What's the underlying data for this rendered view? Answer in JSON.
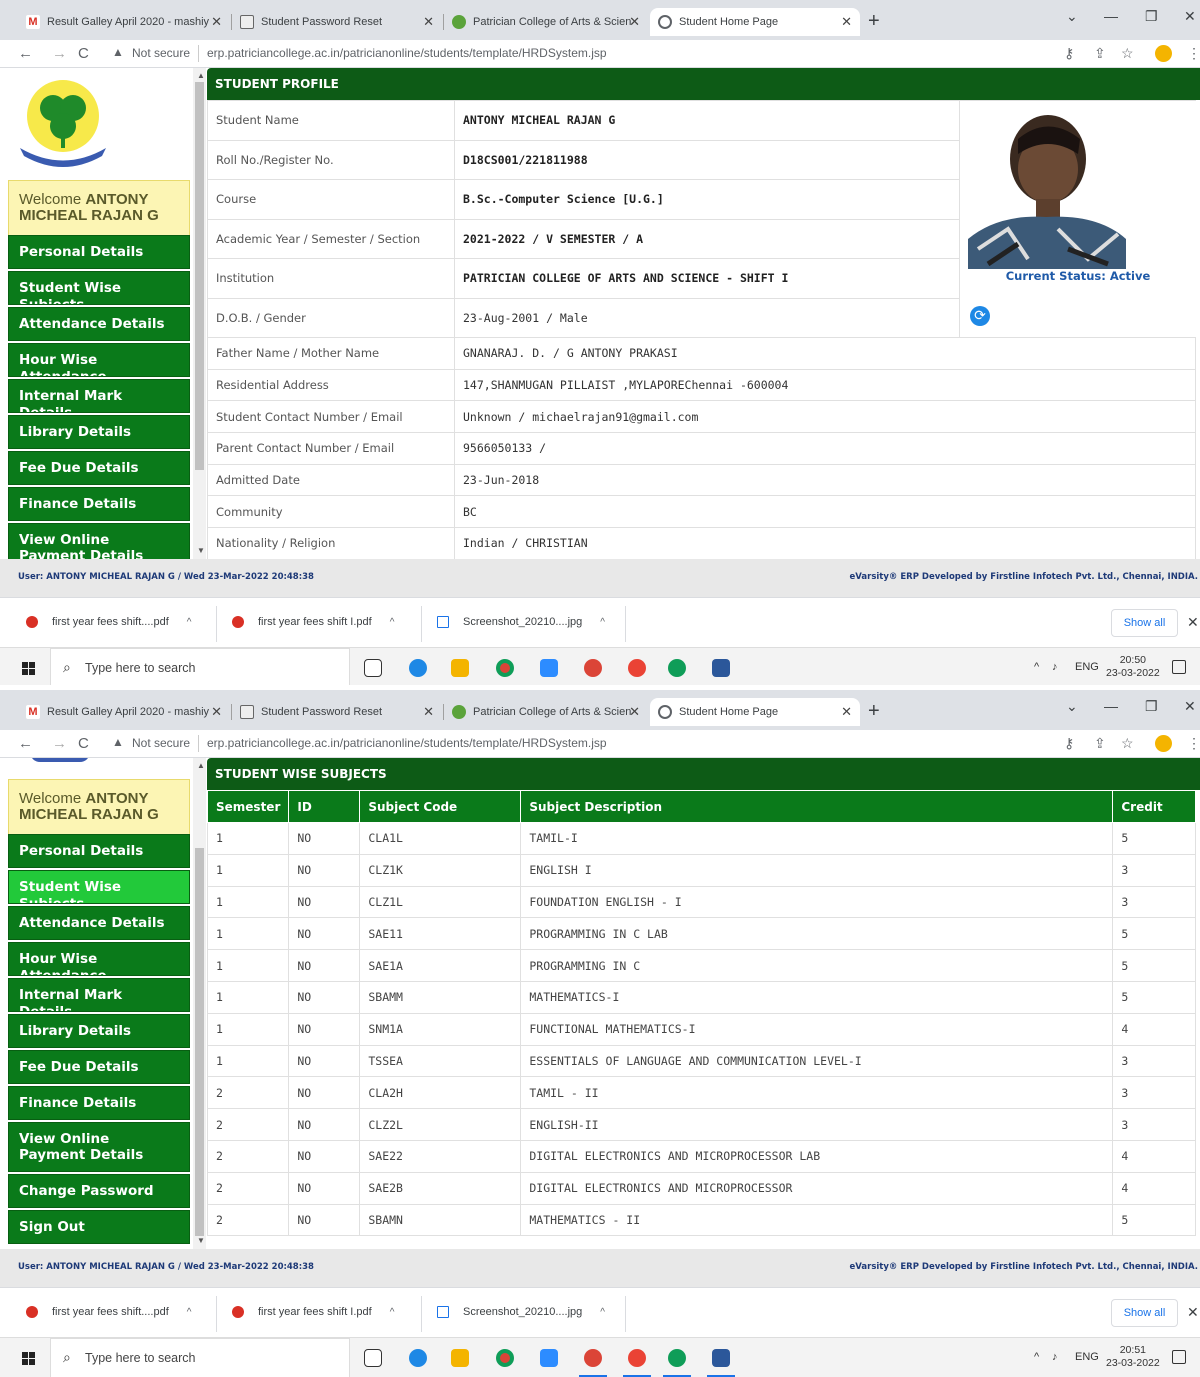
{
  "browser": {
    "tabs": [
      {
        "title": "Result Galley April 2020 - mashiy",
        "favicon": "gmail-icon"
      },
      {
        "title": "Student Password Reset",
        "favicon": "image-icon"
      },
      {
        "title": "Patrician College of Arts & Scien",
        "favicon": "college-icon"
      },
      {
        "title": "Student Home Page",
        "favicon": "globe-icon"
      }
    ],
    "not_secure": "Not secure",
    "url": "erp.patriciancollege.ac.in/patricianonline/students/template/HRDSystem.jsp"
  },
  "sidebar": {
    "welcome_prefix": "Welcome",
    "welcome_name": "ANTONY MICHEAL RAJAN G",
    "menu": [
      "Personal Details",
      "Student Wise Subjects",
      "Attendance Details",
      "Hour Wise Attendance",
      "Internal Mark Details",
      "Library Details",
      "Fee Due Details",
      "Finance Details",
      "View Online Payment Details",
      "Change Password",
      "Sign Out"
    ]
  },
  "profile": {
    "header": "STUDENT PROFILE",
    "rows": [
      {
        "label": "Student Name",
        "value": "ANTONY MICHEAL RAJAN G"
      },
      {
        "label": "Roll No./Register No.",
        "value": "D18CS001/221811988"
      },
      {
        "label": "Course",
        "value": "B.Sc.-Computer Science [U.G.]"
      },
      {
        "label": "Academic Year / Semester / Section",
        "value": "2021-2022 / V SEMESTER / A"
      },
      {
        "label": "Institution",
        "value": "PATRICIAN COLLEGE OF ARTS AND SCIENCE - SHIFT I"
      },
      {
        "label": "D.O.B. / Gender",
        "value": "23-Aug-2001 / Male"
      },
      {
        "label": "Father Name / Mother Name",
        "value": "GNANARAJ. D. / G ANTONY PRAKASI"
      },
      {
        "label": "Residential Address",
        "value": "147,SHANMUGAN PILLAIST ,MYLAPOREChennai -600004"
      },
      {
        "label": "Student Contact Number / Email",
        "value": "Unknown / michaelrajan91@gmail.com"
      },
      {
        "label": "Parent Contact Number / Email",
        "value": "9566050133 /"
      },
      {
        "label": "Admitted Date",
        "value": "23-Jun-2018"
      },
      {
        "label": "Community",
        "value": "BC"
      },
      {
        "label": "Nationality / Religion",
        "value": "Indian / CHRISTIAN"
      }
    ],
    "status": "Current Status: Active"
  },
  "subjects": {
    "header": "STUDENT WISE SUBJECTS",
    "columns": [
      "Semester",
      "ID",
      "Subject Code",
      "Subject Description",
      "Credit"
    ],
    "rows": [
      [
        "1",
        "NO",
        "CLA1L",
        "TAMIL-I",
        "5"
      ],
      [
        "1",
        "NO",
        "CLZ1K",
        "ENGLISH I",
        "3"
      ],
      [
        "1",
        "NO",
        "CLZ1L",
        "FOUNDATION ENGLISH - I",
        "3"
      ],
      [
        "1",
        "NO",
        "SAE11",
        "PROGRAMMING IN C LAB",
        "5"
      ],
      [
        "1",
        "NO",
        "SAE1A",
        "PROGRAMMING IN C",
        "5"
      ],
      [
        "1",
        "NO",
        "SBAMM",
        "MATHEMATICS-I",
        "5"
      ],
      [
        "1",
        "NO",
        "SNM1A",
        "FUNCTIONAL MATHEMATICS-I",
        "4"
      ],
      [
        "1",
        "NO",
        "TSSEA",
        "ESSENTIALS OF LANGUAGE AND COMMUNICATION LEVEL-I",
        "3"
      ],
      [
        "2",
        "NO",
        "CLA2H",
        "TAMIL - II",
        "3"
      ],
      [
        "2",
        "NO",
        "CLZ2L",
        "ENGLISH-II",
        "3"
      ],
      [
        "2",
        "NO",
        "SAE22",
        "DIGITAL ELECTRONICS AND MICROPROCESSOR LAB",
        "4"
      ],
      [
        "2",
        "NO",
        "SAE2B",
        "DIGITAL ELECTRONICS AND MICROPROCESSOR",
        "4"
      ],
      [
        "2",
        "NO",
        "SBAMN",
        "MATHEMATICS - II",
        "5"
      ]
    ]
  },
  "footer": {
    "user_line_1": "User: ANTONY MICHEAL RAJAN G / Wed 23-Mar-2022 20:48:38",
    "user_line_2": "User: ANTONY MICHEAL RAJAN G / Wed 23-Mar-2022 20:48:38",
    "credit": "eVarsity® ERP Developed by Firstline Infotech Pvt. Ltd., Chennai, INDIA."
  },
  "downloads": {
    "items": [
      "first year fees shift....pdf",
      "first year fees shift I.pdf",
      "Screenshot_20210....jpg"
    ],
    "show_all": "Show all"
  },
  "taskbar": {
    "search_placeholder": "Type here to search",
    "lang": "ENG",
    "time_1": "20:50",
    "time_2": "20:51",
    "date": "23-03-2022"
  },
  "colors": {
    "menu_green": "#0a7a1a",
    "menu_active": "#22c93a",
    "header_dark_green": "#0d5b16",
    "welcome_yellow": "#fcf5b4",
    "status_blue": "#1f5aa8"
  }
}
